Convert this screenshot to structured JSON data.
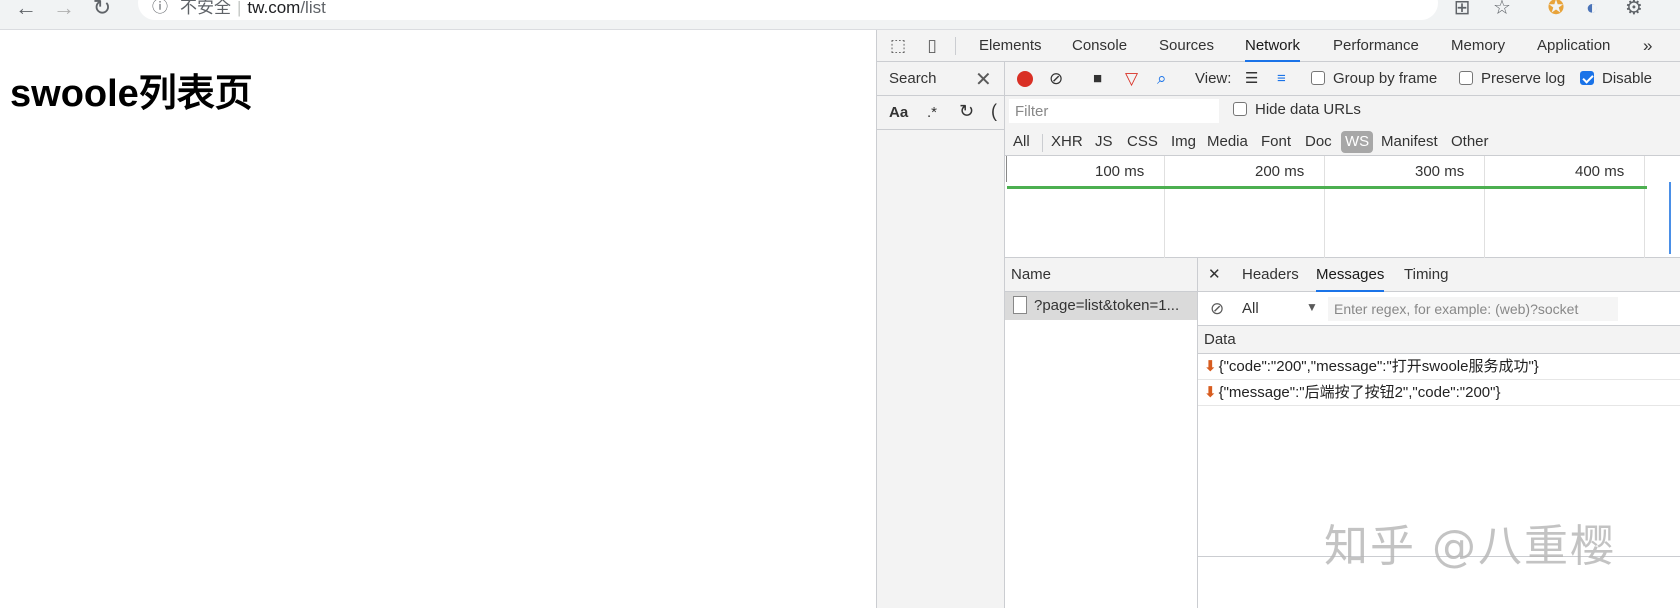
{
  "browser": {
    "security_label": "不安全",
    "url_host": "tw.com",
    "url_path": "/list",
    "icons": [
      "back-arrow-icon",
      "forward-arrow-icon",
      "reload-icon",
      "info-icon",
      "translate-icon",
      "star-icon",
      "extension-icon",
      "settings-gear-icon"
    ]
  },
  "page": {
    "title": "swoole列表页"
  },
  "devtools": {
    "tabs": [
      "Elements",
      "Console",
      "Sources",
      "Network",
      "Performance",
      "Memory",
      "Application"
    ],
    "active_tab": "Network",
    "more_tabs": "»",
    "search_panel": {
      "title": "Search",
      "case_label": "Aa",
      "regex_label": ".*"
    },
    "network": {
      "view_label": "View:",
      "group_by_frame": "Group by frame",
      "preserve_log": "Preserve log",
      "disable_cache": "Disable",
      "filter_placeholder": "Filter",
      "hide_data_urls": "Hide data URLs",
      "types": [
        "All",
        "XHR",
        "JS",
        "CSS",
        "Img",
        "Media",
        "Font",
        "Doc",
        "WS",
        "Manifest",
        "Other"
      ],
      "active_type": "WS",
      "timeline_ticks": [
        "100 ms",
        "200 ms",
        "300 ms",
        "400 ms"
      ],
      "name_header": "Name",
      "requests": [
        "?page=list&token=1..."
      ],
      "detail_tabs": [
        "Headers",
        "Messages",
        "Timing"
      ],
      "active_detail_tab": "Messages",
      "message_filter_value": "All",
      "message_filter_placeholder": "Enter regex, for example: (web)?socket",
      "data_header": "Data",
      "messages": [
        "{\"code\":\"200\",\"message\":\"打开swoole服务成功\"}",
        "{\"message\":\"后端按了按钮2\",\"code\":\"200\"}"
      ]
    }
  },
  "watermark": "知乎 @八重樱",
  "colors": {
    "record": "#d93025",
    "accent": "#1a73e8",
    "timeline_bar": "#4caf50",
    "incoming_arrow": "#d75c1f"
  }
}
